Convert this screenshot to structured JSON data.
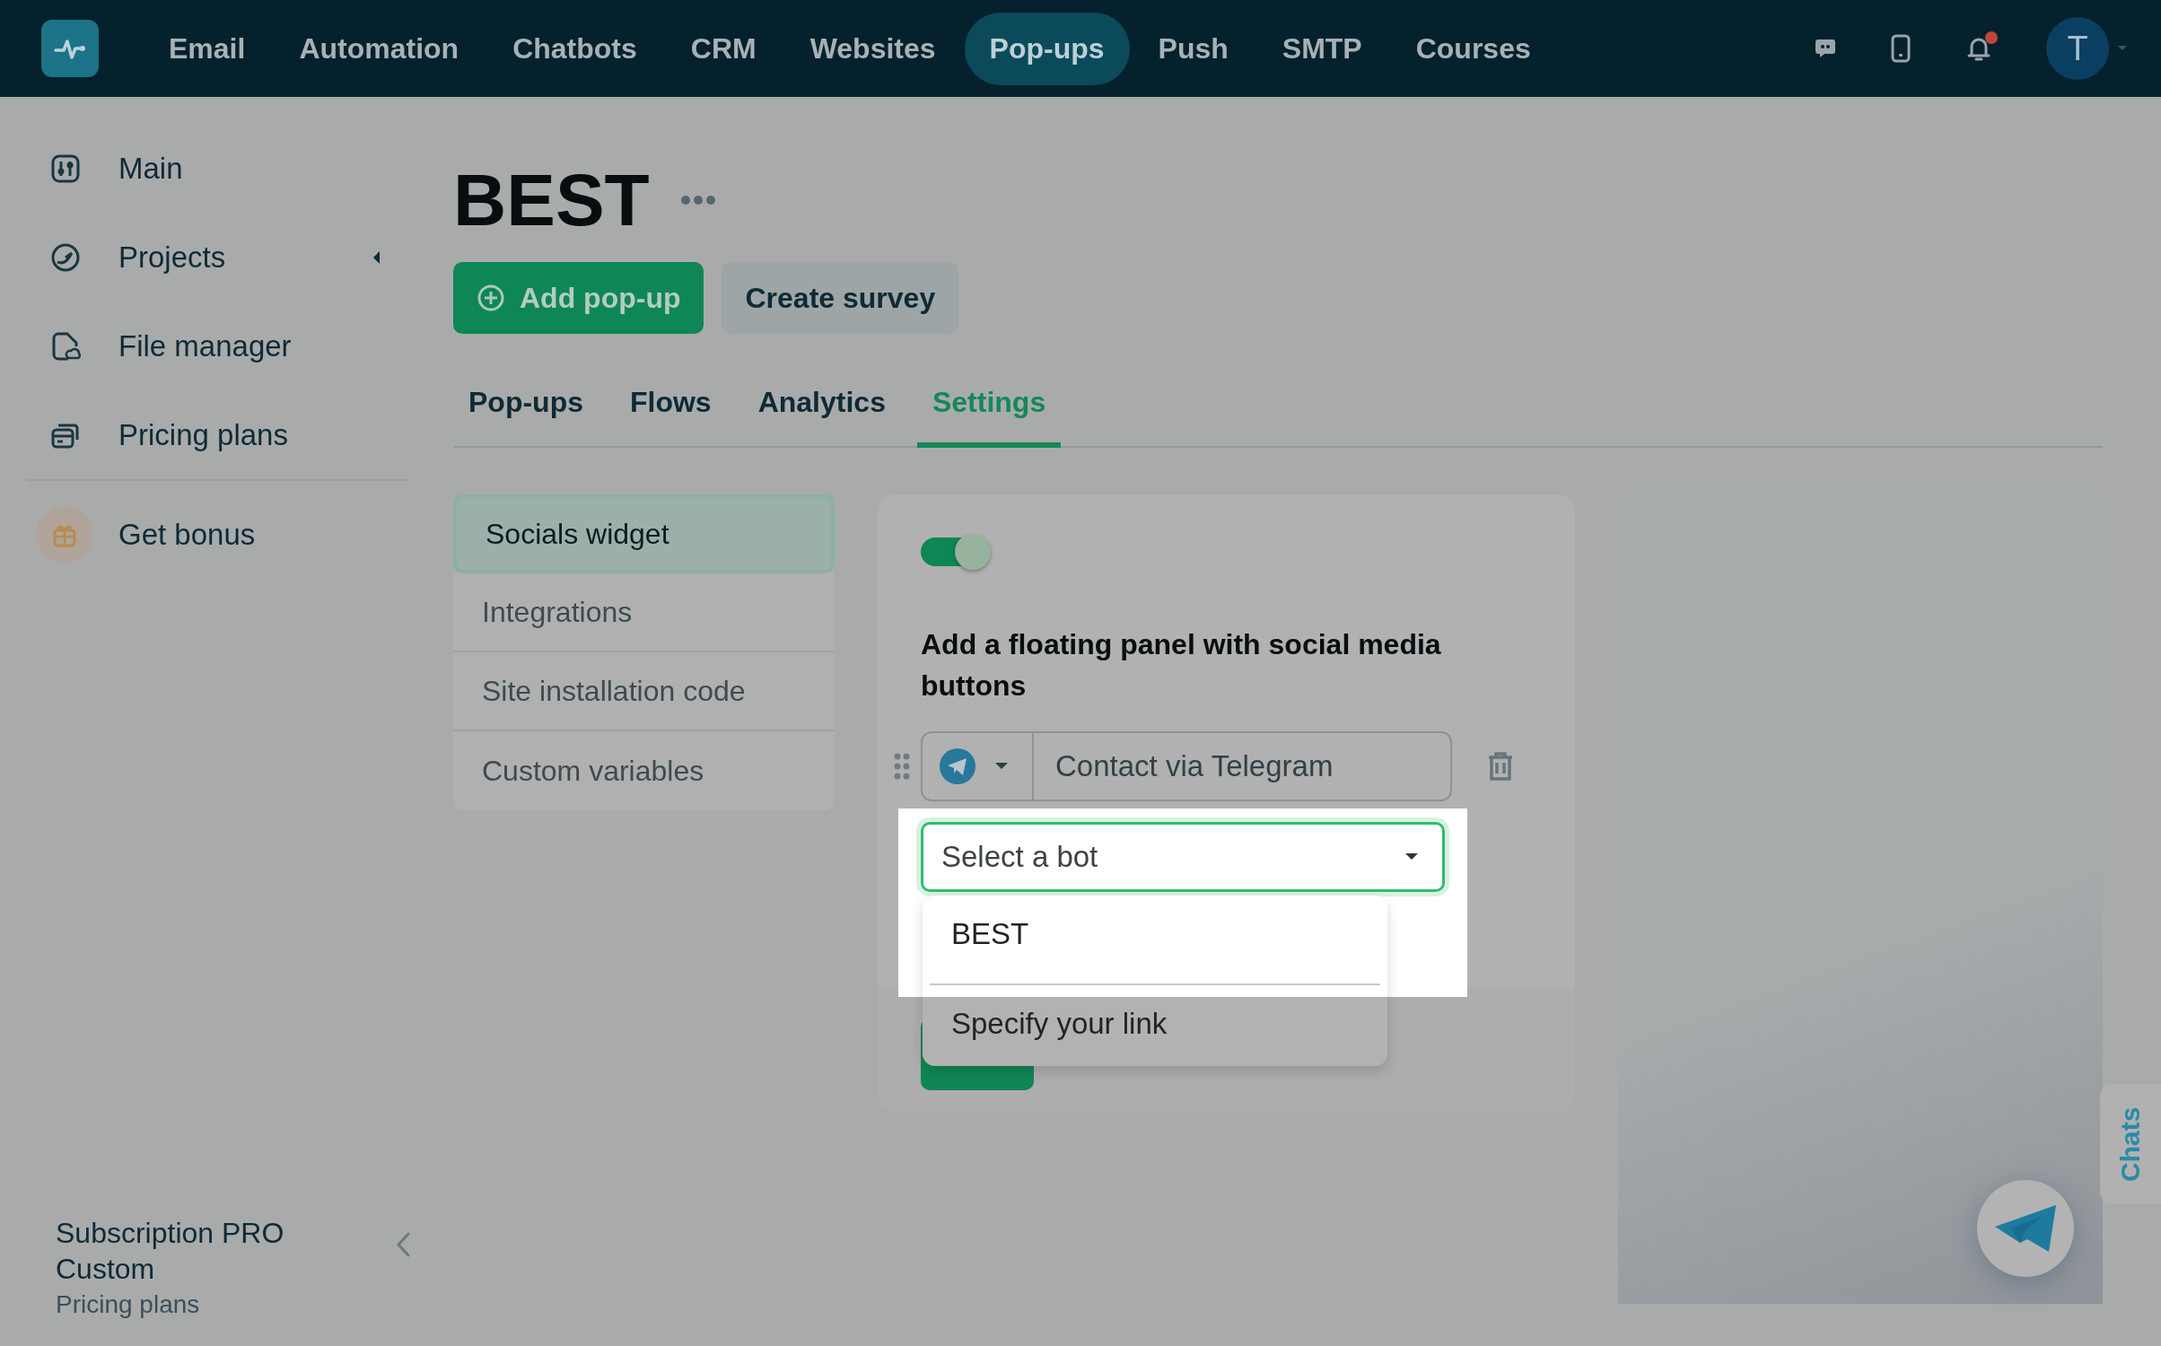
{
  "nav": {
    "items": [
      {
        "label": "Email",
        "selected": false
      },
      {
        "label": "Automation",
        "selected": false
      },
      {
        "label": "Chatbots",
        "selected": false
      },
      {
        "label": "CRM",
        "selected": false
      },
      {
        "label": "Websites",
        "selected": false
      },
      {
        "label": "Pop-ups",
        "selected": true
      },
      {
        "label": "Push",
        "selected": false
      },
      {
        "label": "SMTP",
        "selected": false
      },
      {
        "label": "Courses",
        "selected": false
      }
    ],
    "unread_notifications": true,
    "avatar": "T"
  },
  "sidebar": {
    "items": [
      {
        "label": "Main",
        "expandable": false
      },
      {
        "label": "Projects",
        "expandable": true
      },
      {
        "label": "File manager",
        "expandable": false
      },
      {
        "label": "Pricing plans",
        "expandable": false
      }
    ],
    "bonus": "Get bonus",
    "plan": "Subscription PRO Custom",
    "plan_link": "Pricing plans"
  },
  "page": {
    "title": "BEST",
    "actions": [
      {
        "label": "Add pop-up",
        "kind": "primary"
      },
      {
        "label": "Create survey",
        "kind": "secondary"
      }
    ]
  },
  "tabs": [
    {
      "label": "Pop-ups",
      "selected": false
    },
    {
      "label": "Flows",
      "selected": false
    },
    {
      "label": "Analytics",
      "selected": false
    },
    {
      "label": "Settings",
      "selected": true
    }
  ],
  "settings_menu": [
    {
      "label": "Socials widget",
      "selected": true
    },
    {
      "label": "Integrations",
      "selected": false
    },
    {
      "label": "Site installation code",
      "selected": false
    },
    {
      "label": "Custom variables",
      "selected": false
    }
  ],
  "widget": {
    "on": true,
    "heading": "Add a floating panel with social media buttons",
    "button_text": "Contact via Telegram",
    "bot_select": {
      "placeholder": "Select a bot"
    },
    "options": [
      "BEST",
      "Specify your link"
    ]
  },
  "chats_tab": "Chats"
}
